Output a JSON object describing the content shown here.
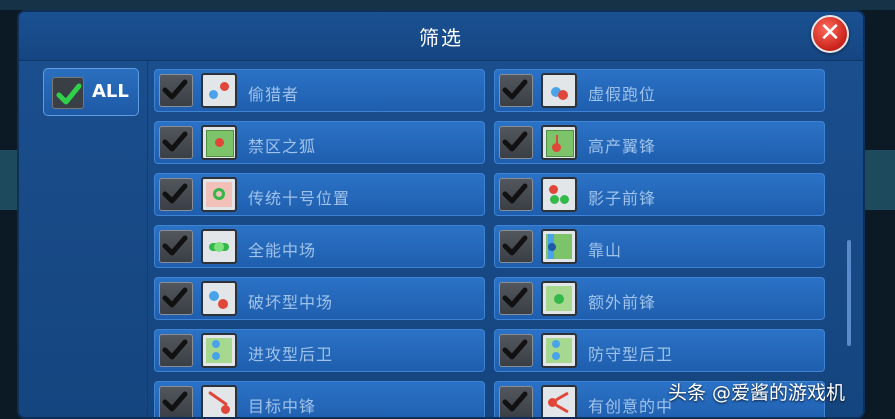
{
  "dialog": {
    "title": "筛选",
    "close_glyph": "✕",
    "all_label": "ALL"
  },
  "filters": {
    "left": [
      {
        "label": "偷猎者",
        "checked": true,
        "icon": "poacher-role-icon"
      },
      {
        "label": "禁区之狐",
        "checked": true,
        "icon": "fox-in-the-box-role-icon"
      },
      {
        "label": "传统十号位置",
        "checked": true,
        "icon": "classic-no10-role-icon"
      },
      {
        "label": "全能中场",
        "checked": true,
        "icon": "box-to-box-role-icon"
      },
      {
        "label": "破坏型中场",
        "checked": true,
        "icon": "destroyer-role-icon"
      },
      {
        "label": "进攻型后卫",
        "checked": true,
        "icon": "offensive-fullback-role-icon"
      },
      {
        "label": "目标中锋",
        "checked": true,
        "icon": "target-man-role-icon"
      }
    ],
    "right": [
      {
        "label": "虚假跑位",
        "checked": true,
        "icon": "dummy-runner-role-icon"
      },
      {
        "label": "高产翼锋",
        "checked": true,
        "icon": "prolific-winger-role-icon"
      },
      {
        "label": "影子前锋",
        "checked": true,
        "icon": "hole-player-role-icon"
      },
      {
        "label": "靠山",
        "checked": true,
        "icon": "anchor-man-role-icon"
      },
      {
        "label": "额外前锋",
        "checked": true,
        "icon": "extra-frontman-role-icon"
      },
      {
        "label": "防守型后卫",
        "checked": true,
        "icon": "defensive-fullback-role-icon"
      },
      {
        "label": "有创意的中",
        "checked": true,
        "icon": "creative-playmaker-role-icon"
      }
    ]
  },
  "watermark": "头条 @爱酱的游戏机",
  "colors": {
    "panel": "#1b4f8f",
    "item": "#2b72c6",
    "label": "#9fc2ea",
    "check": "#2fd04a",
    "close": "#d9301f"
  }
}
